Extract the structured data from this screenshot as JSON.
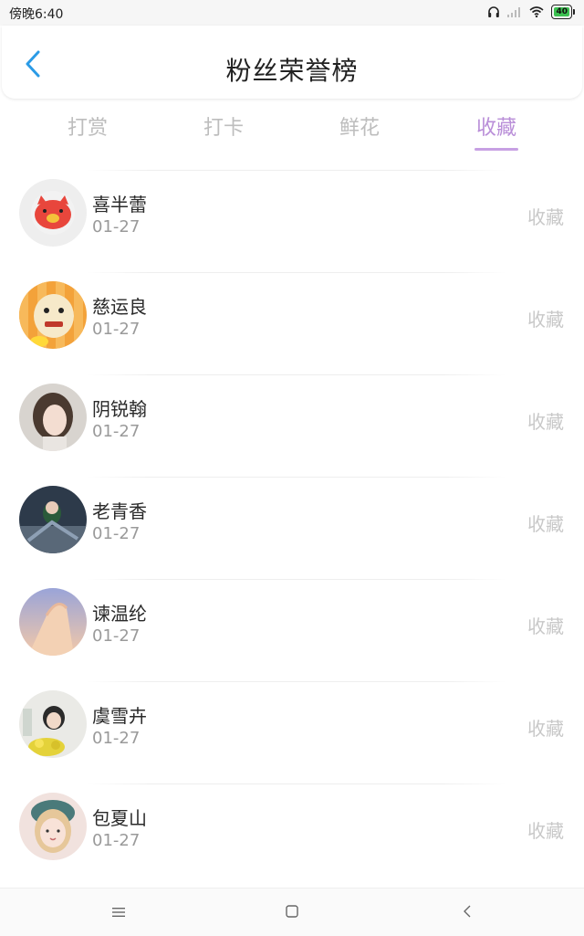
{
  "status_bar": {
    "time": "傍晚6:40",
    "battery_level": "40",
    "icons": [
      "headphones-icon",
      "signal-icon",
      "wifi-icon",
      "battery-icon"
    ]
  },
  "header": {
    "title": "粉丝荣誉榜",
    "back_icon": "chevron-left-icon"
  },
  "tabs": [
    {
      "label": "打赏",
      "active": false
    },
    {
      "label": "打卡",
      "active": false
    },
    {
      "label": "鲜花",
      "active": false
    },
    {
      "label": "收藏",
      "active": true
    }
  ],
  "fans": [
    {
      "name": "喜半蕾",
      "date": "01-27",
      "action": "收藏"
    },
    {
      "name": "慈运良",
      "date": "01-27",
      "action": "收藏"
    },
    {
      "name": "阴锐翰",
      "date": "01-27",
      "action": "收藏"
    },
    {
      "name": "老青香",
      "date": "01-27",
      "action": "收藏"
    },
    {
      "name": "谏温纶",
      "date": "01-27",
      "action": "收藏"
    },
    {
      "name": "虞雪卉",
      "date": "01-27",
      "action": "收藏"
    },
    {
      "name": "包夏山",
      "date": "01-27",
      "action": "收藏"
    }
  ],
  "nav_bar": {
    "icons": [
      "menu-icon",
      "home-square-icon",
      "back-triangle-icon"
    ]
  },
  "colors": {
    "accent_tab": "#b98ed8",
    "back_arrow": "#2b9be6",
    "inactive_text": "#bdbdbd"
  }
}
